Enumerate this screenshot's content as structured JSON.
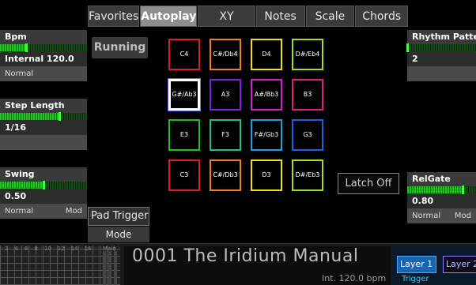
{
  "tabs": [
    {
      "label": "Favorites"
    },
    {
      "label": "Autoplay",
      "active": true
    },
    {
      "label": "XY"
    },
    {
      "label": "Notes"
    },
    {
      "label": "Scale"
    },
    {
      "label": "Chords"
    }
  ],
  "left_panel": {
    "bpm_label": "Bpm",
    "bpm_level": 0.3,
    "bpm_value": "Internal 120.0",
    "bpm_mode": "Normal",
    "step_length_label": "Step Length",
    "step_length_level": 0.68,
    "step_length_value": "1/16",
    "swing_label": "Swing",
    "swing_level": 0.5,
    "swing_value": "0.50",
    "swing_mode": "Normal",
    "swing_mod": "Mod"
  },
  "right_panel": {
    "rhythm_label": "Rhythm Patter",
    "rhythm_level": 0.0,
    "rhythm_value": "2",
    "relgate_label": "RelGate",
    "relgate_level": 0.8,
    "relgate_value": "0.80",
    "relgate_mode": "Normal",
    "relgate_mod": "Mod"
  },
  "center": {
    "running_label": "Running",
    "latch_label": "Latch Off",
    "pad_trigger_label": "Pad Trigger",
    "mode_label": "Mode"
  },
  "pads": [
    {
      "note": "C4",
      "color": "#e02020",
      "row": 0,
      "col": 0
    },
    {
      "note": "C#/Db4",
      "color": "#f08020",
      "row": 0,
      "col": 1
    },
    {
      "note": "D4",
      "color": "#f0e010",
      "row": 0,
      "col": 2
    },
    {
      "note": "D#/Eb4",
      "color": "#a0e020",
      "row": 0,
      "col": 3
    },
    {
      "note": "G#/Ab3",
      "color": "#ffffff",
      "row": 1,
      "col": 0,
      "selected": true
    },
    {
      "note": "A3",
      "color": "#8020e0",
      "row": 1,
      "col": 1
    },
    {
      "note": "A#/Bb3",
      "color": "#d020d0",
      "row": 1,
      "col": 2
    },
    {
      "note": "B3",
      "color": "#e02080",
      "row": 1,
      "col": 3
    },
    {
      "note": "E3",
      "color": "#20c020",
      "row": 2,
      "col": 0
    },
    {
      "note": "F3",
      "color": "#20c080",
      "row": 2,
      "col": 1
    },
    {
      "note": "F#/Gb3",
      "color": "#20a0e0",
      "row": 2,
      "col": 2
    },
    {
      "note": "G3",
      "color": "#2060e0",
      "row": 2,
      "col": 3
    },
    {
      "note": "C3",
      "color": "#e02020",
      "row": 3,
      "col": 0
    },
    {
      "note": "C#/Db3",
      "color": "#f08020",
      "row": 3,
      "col": 1
    },
    {
      "note": "D3",
      "color": "#f0e010",
      "row": 3,
      "col": 2
    },
    {
      "note": "D#/Eb3",
      "color": "#a0e020",
      "row": 3,
      "col": 3
    }
  ],
  "bottom": {
    "step_numbers": [
      "2",
      "4",
      "6",
      "8",
      "10",
      "12",
      "14",
      "16"
    ],
    "step_main": "Main",
    "preset_title": "0001 The Iridium Manual",
    "tempo": "Int. 120.0 bpm",
    "layer1": "Layer 1",
    "layer2": "Layer 2",
    "trigger": "Trigger"
  }
}
